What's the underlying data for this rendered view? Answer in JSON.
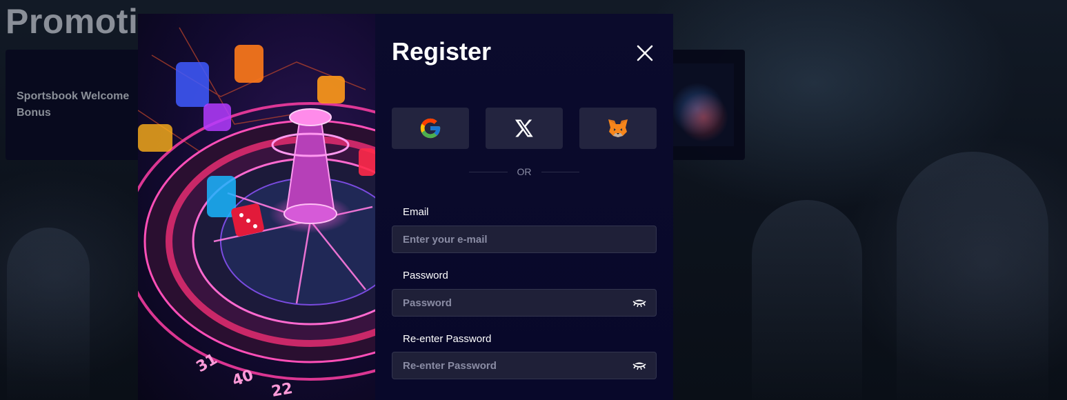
{
  "page": {
    "title": "Promotions",
    "promo_card_label": "Sportsbook Welcome Bonus"
  },
  "modal": {
    "title": "Register",
    "social": [
      {
        "icon": "google-icon"
      },
      {
        "icon": "x-icon"
      },
      {
        "icon": "metamask-fox-icon"
      }
    ],
    "divider_text": "OR",
    "fields": {
      "email": {
        "label": "Email",
        "value": "",
        "placeholder": "Enter your e-mail"
      },
      "password": {
        "label": "Password",
        "value": "",
        "placeholder": "Password"
      },
      "confirm": {
        "label": "Re-enter Password",
        "value": "",
        "placeholder": "Re-enter Password"
      }
    }
  },
  "colors": {
    "modal_bg": "#0b0b2c",
    "button_bg": "#23243f",
    "input_bg": "#1f2038",
    "muted_text": "#8a8ca4"
  }
}
